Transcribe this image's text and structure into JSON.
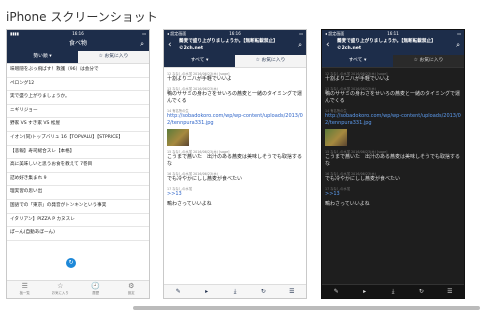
{
  "heading": "iPhone スクリーンショット",
  "phone1": {
    "status_carrier": "▮▮▮▮",
    "status_time": "16:16",
    "status_battery": "▭",
    "title": "食べ物",
    "seg_active": "勢い順 ▾",
    "seg_inactive": "☆ お気に入り",
    "rows": [
      {
        "title": "味噌隠をぶっ飛ばす！救護（96）は会分で",
        "count": ""
      },
      {
        "title": "ペロング12",
        "count": ""
      },
      {
        "title": "実で盛り上がりましょうか。",
        "count": ""
      },
      {
        "title": "ニギリジョー",
        "count": ""
      },
      {
        "title": "野家 VS すき家 VS 松屋",
        "count": ""
      },
      {
        "title": "イオン(同)トップバリュ 16【TOPVALU】【STPRICE】",
        "count": ""
      },
      {
        "title": "【悲報】寿司総合スレ【本格】",
        "count": ""
      },
      {
        "title": "高に美味しいと思うお食を教えて 7巻目",
        "count": ""
      },
      {
        "title": "詰め好き集まれ 9",
        "count": ""
      },
      {
        "title": "理実習の思い出",
        "count": ""
      },
      {
        "title": "国語での「東京」の発音がトンキンという事実",
        "count": ""
      },
      {
        "title": "イタリアン】PIZZA P カヌスレ",
        "count": ""
      },
      {
        "title": "ぽーん(自動あぼーん)",
        "count": ""
      }
    ],
    "tabs": [
      {
        "icon": "☰",
        "label": "板一覧"
      },
      {
        "icon": "☆",
        "label": "お気に入り"
      },
      {
        "icon": "🕘",
        "label": "履歴"
      },
      {
        "icon": "⚙",
        "label": "設定"
      }
    ],
    "refresh_icon": "↻"
  },
  "phone2": {
    "status_carrier": "◂ 設定画面",
    "status_time": "16:16",
    "status_battery": "▭",
    "back": "‹",
    "title": "蕎麦で盛り上がりましょうか。【無断転載禁止】©2ch.net",
    "seg_active": "すべて ▾",
    "seg_inactive": "☆ お気に入り",
    "posts": [
      {
        "hdr": "12 ななしの水蛍 2016/06/23(木) [sage]",
        "body": "十割よりニ八が手軽でいいよ",
        "link": "",
        "thumb": false
      },
      {
        "hdr": "13 ななしの水蛍 2016/06/23(木)",
        "body": "鴨のササミの身わさをせいろの蕎麦と一緒のタイミングで運んでくる",
        "link": "",
        "thumb": false
      },
      {
        "hdr": "14 有名所の生",
        "body": "",
        "link": "http://sobadokoro.com/wp/wp-content/uploads/2013/02/tennpura331.jpg",
        "thumb": true
      },
      {
        "hdr": "15 ななしの水蛍 2016/06/23(木) [sage]",
        "body": "こうまで蕎いた　出汁のある蕎麦は美味しそうでも取捨するな",
        "link": "",
        "thumb": false
      },
      {
        "hdr": "16 ななしの水蛍 2016/06/23(木)",
        "body": "でも冷やかにしし蕎麦が食べたい",
        "link": "",
        "thumb": false
      },
      {
        "hdr": "17 ななしの水蛍",
        "body": "",
        "link": ">>13",
        "thumb": false
      },
      {
        "hdr": "",
        "body": "鴫わさっていいよね",
        "link": "",
        "thumb": false
      }
    ],
    "toolbar": [
      "✎",
      "▸",
      "⤓",
      "↻",
      "☰"
    ]
  },
  "phone3": {
    "status_carrier": "◂ 設定画面",
    "status_time": "16:11",
    "status_battery": "▭",
    "back": "‹",
    "title": "蕎麦で盛り上がりましょうか。【無断転載禁止】©2ch.net",
    "seg_active": "すべて ▾",
    "seg_inactive": "☆ お気に入り",
    "posts": [
      {
        "hdr": "12 ななしの水蛍 2016/06/23(木) [sage]",
        "body": "十割よりニ八が手軽でいいよ",
        "link": "",
        "thumb": false
      },
      {
        "hdr": "13 ななしの水蛍 2016/06/23(木)",
        "body": "鴨のササミの身わさをせいろの蕎麦と一緒のタイミングで運んでくる",
        "link": "",
        "thumb": false
      },
      {
        "hdr": "14 有名所の生",
        "body": "",
        "link": "http://sobadokoro.com/wp/wp-content/uploads/2013/02/tennpura331.jpg",
        "thumb": true
      },
      {
        "hdr": "15 ななしの水蛍 2016/06/23(木) [sage]",
        "body": "こうまで蕎いた　出汁のある蕎麦は美味しそうでも取捨するな",
        "link": "",
        "thumb": false
      },
      {
        "hdr": "16 ななしの水蛍 2016/06/23(木)",
        "body": "でも冷やかにしし蕎麦が食べたい",
        "link": "",
        "thumb": false
      },
      {
        "hdr": "17 ななしの水蛍",
        "body": "",
        "link": ">>13",
        "thumb": false
      },
      {
        "hdr": "",
        "body": "鴫わさっていいよね",
        "link": "",
        "thumb": false
      }
    ],
    "toolbar": [
      "✎",
      "▸",
      "⤓",
      "↻",
      "☰"
    ]
  },
  "search_icon": "⌕"
}
